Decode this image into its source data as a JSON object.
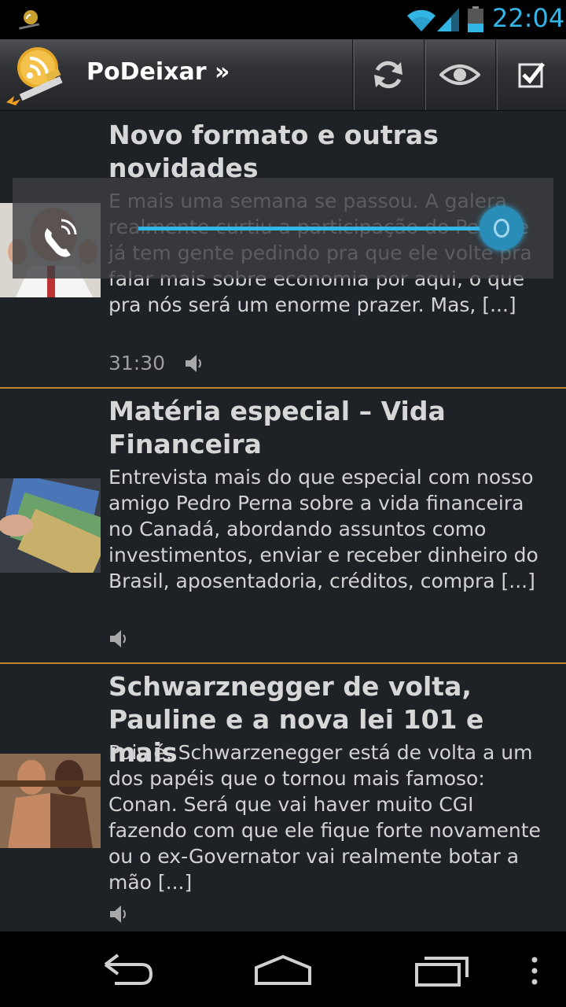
{
  "status_bar": {
    "time": "22:04",
    "icons": [
      "app-notification-icon",
      "wifi-icon",
      "signal-icon",
      "battery-icon"
    ],
    "accent_color": "#33b5e5"
  },
  "action_bar": {
    "title": "PoDeixar »",
    "actions": [
      {
        "name": "refresh-icon"
      },
      {
        "name": "eye-icon"
      },
      {
        "name": "checkbox-icon"
      }
    ]
  },
  "feed": {
    "divider_color": "#b88a2a",
    "items": [
      {
        "title": "Novo formato e outras novidades",
        "description": "E mais uma semana se passou. A galera realmente curtiu a participação do Pedro e já tem gente pedindo pra que ele volte pra falar mais sobre economia por aqui, o que pra nós será um enorme prazer. Mas, [...]",
        "duration": "31:30",
        "icon": "speaker-icon"
      },
      {
        "title": "Matéria especial – Vida Financeira",
        "description": "Entrevista mais do que especial com nosso amigo Pedro Perna sobre a vida financeira no Canadá, abordando assuntos como investimentos, enviar e receber dinheiro do Brasil, aposentadoria, créditos, compra [...]",
        "duration": "",
        "icon": "speaker-icon"
      },
      {
        "title": "Schwarznegger de volta, Pauline e a nova lei 101 e mais",
        "description": "Pois é, Schwarzenegger está de volta a um dos papéis que o tornou mais famoso: Conan. Será que vai haver muito CGI fazendo com que ele fique forte novamente ou o ex-Governator vai realmente botar a mão [...]",
        "duration": "",
        "icon": "speaker-icon"
      }
    ]
  },
  "overlay": {
    "icon": "phone-call-icon",
    "slider_progress": 1.0
  },
  "nav_bar": {
    "buttons": [
      "back-icon",
      "home-icon",
      "recents-icon",
      "menu-icon"
    ]
  }
}
